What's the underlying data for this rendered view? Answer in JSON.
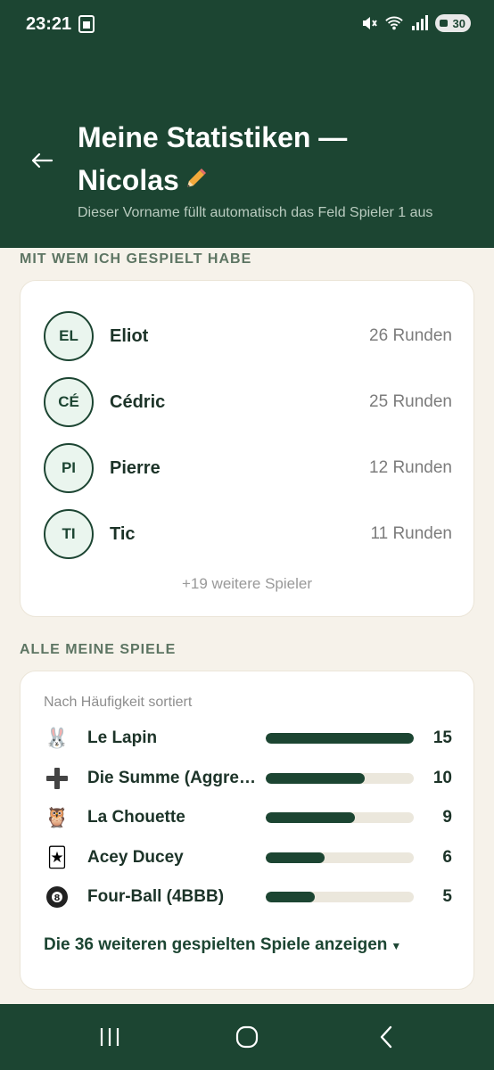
{
  "status_bar": {
    "time": "23:21",
    "battery": "30"
  },
  "header": {
    "title": "Meine Statistiken — Nicolas",
    "subtitle": "Dieser Vorname füllt automatisch das Feld Spieler 1 aus"
  },
  "players_section": {
    "label": "MIT WEM ICH GESPIELT HABE",
    "players": [
      {
        "initials": "EL",
        "name": "Eliot",
        "rounds": "26 Runden"
      },
      {
        "initials": "CÉ",
        "name": "Cédric",
        "rounds": "25 Runden"
      },
      {
        "initials": "PI",
        "name": "Pierre",
        "rounds": "12 Runden"
      },
      {
        "initials": "TI",
        "name": "Tic",
        "rounds": "11 Runden"
      }
    ],
    "more": "+19 weitere Spieler"
  },
  "games_section": {
    "label": "ALLE MEINE SPIELE",
    "sorted_label": "Nach Häufigkeit sortiert",
    "games": [
      {
        "icon": "rabbit-icon",
        "glyph": "🐰",
        "name": "Le Lapin",
        "count": "15",
        "fraction": 1.0
      },
      {
        "icon": "plus-icon",
        "glyph": "➕",
        "name": "Die Summe (Aggregat)",
        "count": "10",
        "fraction": 0.667
      },
      {
        "icon": "owl-icon",
        "glyph": "🦉",
        "name": "La Chouette",
        "count": "9",
        "fraction": 0.6
      },
      {
        "icon": "playing-card-icon",
        "glyph": "🃏",
        "name": "Acey Ducey",
        "count": "6",
        "fraction": 0.4
      },
      {
        "icon": "eight-ball-icon",
        "glyph": "🎱",
        "name": "Four-Ball (4BBB)",
        "count": "5",
        "fraction": 0.333
      }
    ],
    "show_more": "Die 36 weiteren gespielten Spiele anzeigen"
  },
  "colors": {
    "primary": "#1c4532",
    "background": "#f6f2ea",
    "bar_track": "#ebe7dc"
  }
}
